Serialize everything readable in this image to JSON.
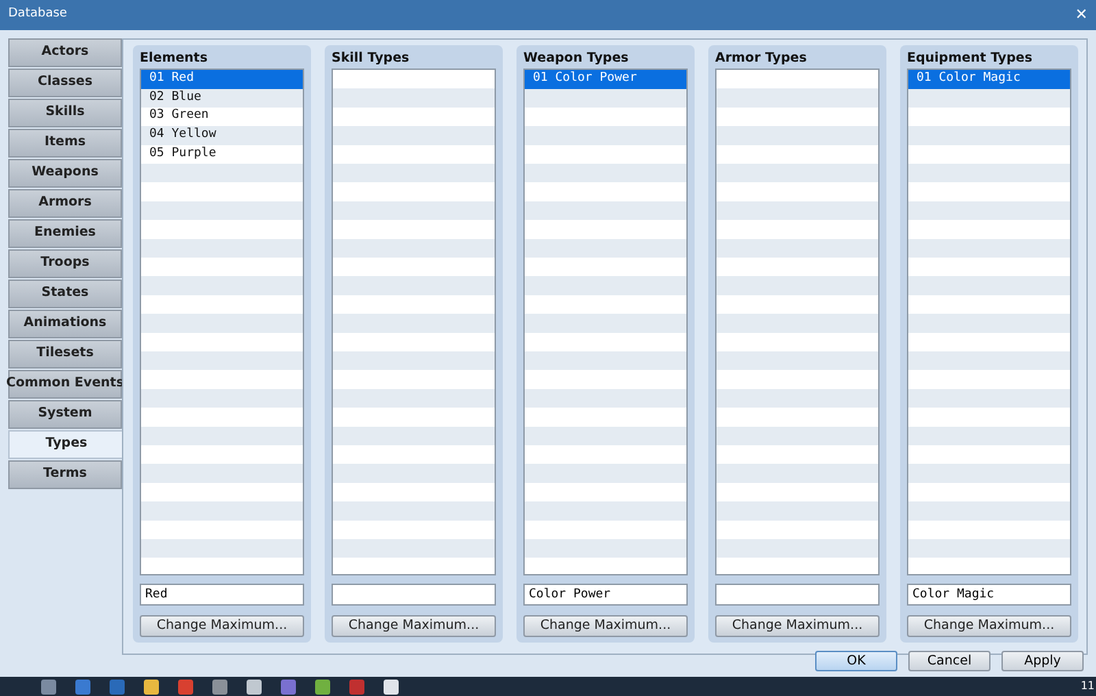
{
  "window": {
    "title": "Database",
    "close": "✕"
  },
  "tabs": [
    {
      "label": "Actors",
      "selected": false
    },
    {
      "label": "Classes",
      "selected": false
    },
    {
      "label": "Skills",
      "selected": false
    },
    {
      "label": "Items",
      "selected": false
    },
    {
      "label": "Weapons",
      "selected": false
    },
    {
      "label": "Armors",
      "selected": false
    },
    {
      "label": "Enemies",
      "selected": false
    },
    {
      "label": "Troops",
      "selected": false
    },
    {
      "label": "States",
      "selected": false
    },
    {
      "label": "Animations",
      "selected": false
    },
    {
      "label": "Tilesets",
      "selected": false
    },
    {
      "label": "Common Events",
      "selected": false
    },
    {
      "label": "System",
      "selected": false
    },
    {
      "label": "Types",
      "selected": true
    },
    {
      "label": "Terms",
      "selected": false
    }
  ],
  "panels": [
    {
      "title": "Elements",
      "items": [
        {
          "label": "01 Red",
          "selected": true
        },
        {
          "label": "02 Blue",
          "selected": false
        },
        {
          "label": "03 Green",
          "selected": false
        },
        {
          "label": "04 Yellow",
          "selected": false
        },
        {
          "label": "05 Purple",
          "selected": false
        }
      ],
      "value": "Red",
      "button": "Change Maximum..."
    },
    {
      "title": "Skill Types",
      "button": "Change Maximum..."
    },
    {
      "title": "Weapon Types",
      "items": [
        {
          "label": "01 Color Power",
          "selected": true
        }
      ],
      "value": "Color Power",
      "button": "Change Maximum..."
    },
    {
      "title": "Armor Types",
      "button": "Change Maximum..."
    },
    {
      "title": "Equipment Types",
      "items": [
        {
          "label": "01 Color Magic",
          "selected": true
        }
      ],
      "value": "Color Magic",
      "button": "Change Maximum..."
    }
  ],
  "dialog_buttons": [
    {
      "label": "OK",
      "selected": true
    },
    {
      "label": "Cancel",
      "selected": false
    },
    {
      "label": "Apply",
      "selected": false
    }
  ],
  "taskbar": {
    "clock": "11"
  }
}
